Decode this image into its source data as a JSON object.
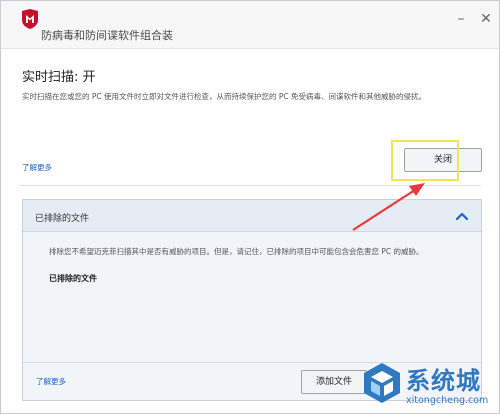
{
  "window": {
    "title": "防病毒和防间谍软件组合装",
    "minimize_glyph": "–",
    "close_glyph": "✕",
    "brand_color": "#c8102e"
  },
  "header": {
    "title": "实时扫描: 开",
    "description": "实时扫描在您或您的 PC 使用文件时立即对文件进行检查，从而持续保护您的 PC 免受病毒、间谍软件和其他威胁的侵扰。",
    "learn_more": "了解更多",
    "close_button": "关闭"
  },
  "panel": {
    "title": "已排除的文件",
    "description": "排除您不希望迈克菲扫描其中是否有威胁的项目。但是，请记住，已排除的项目中可能包含会危害您 PC 的威胁。",
    "subheading": "已排除的文件",
    "learn_more": "了解更多",
    "add_button": "添加文件"
  },
  "watermark": {
    "text": "系统城",
    "url": "xitongcheng.com",
    "color": "#2f78c2"
  },
  "annotation": {
    "highlight_color": "#f3e64b",
    "arrow_color": "#e8393f"
  }
}
